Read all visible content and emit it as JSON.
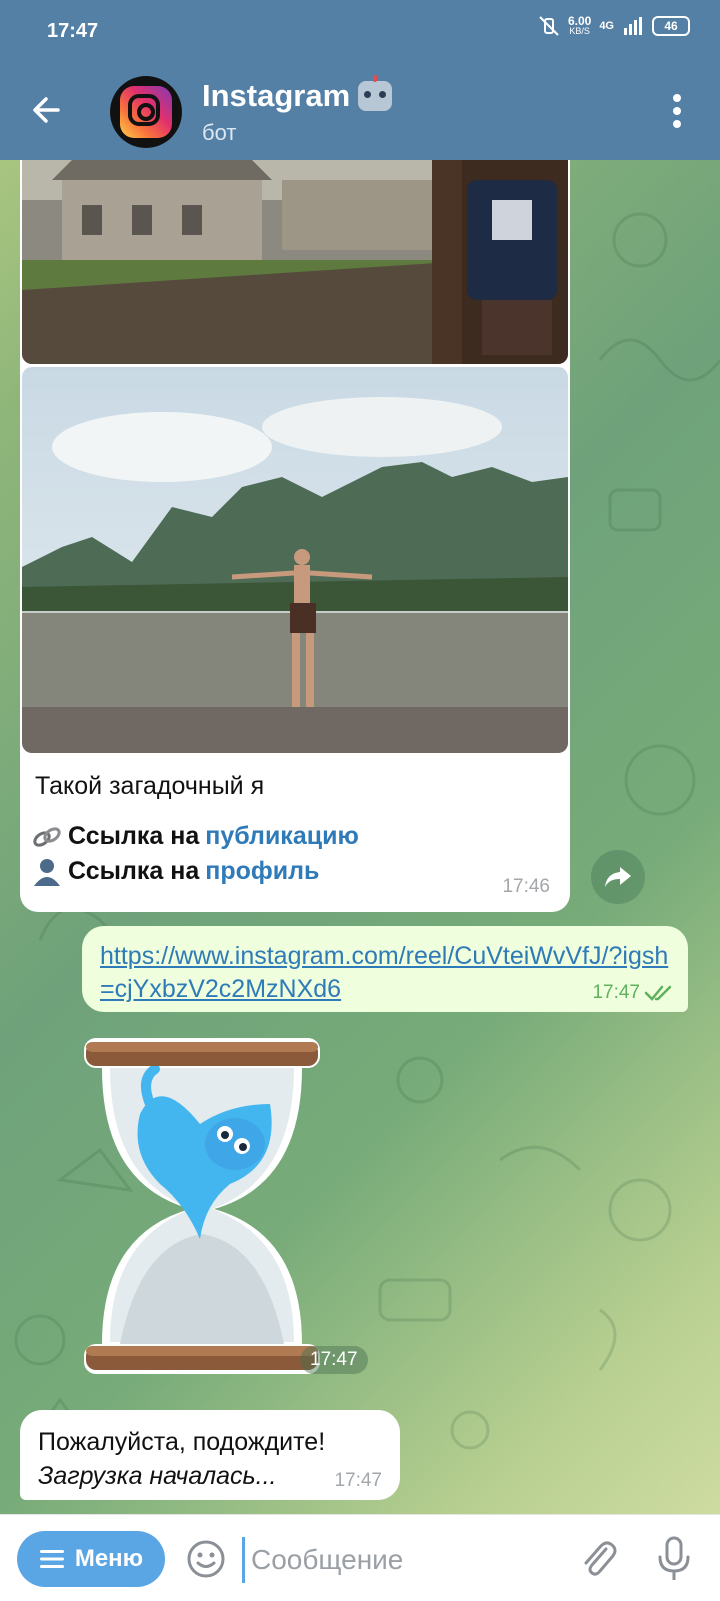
{
  "status_bar": {
    "time": "17:47",
    "network_speed": "6.00",
    "network_unit": "KB/S",
    "network_type": "4G",
    "battery": "46"
  },
  "header": {
    "title": "Instagram",
    "subtitle": "бот",
    "title_icon": "robot-emoji"
  },
  "messages": {
    "media_caption": "Такой загадочный я",
    "publication_link": {
      "text": "Ссылка на ",
      "link": "публикацию",
      "emoji": "link-emoji"
    },
    "profile_link": {
      "text": "Ссылка на ",
      "link": "профиль",
      "emoji": "bust-in-silhouette-emoji"
    },
    "media_time": "17:46",
    "outgoing_url": "https://www.instagram.com/reel/CuVteiWvVfJ/?igsh=cjYxbzV2c2MzNXd6",
    "outgoing_time": "17:47",
    "sticker_time": "17:47",
    "wait_line1": "Пожалуйста, подождите!",
    "wait_line2": "Загрузка началась...",
    "wait_time": "17:47"
  },
  "composer": {
    "menu_label": "Меню",
    "placeholder": "Сообщение"
  },
  "colors": {
    "header": "#5580a6",
    "link": "#2f7ab8",
    "outgoing_bubble": "#effedd",
    "menu_button": "#5aa6e4"
  }
}
